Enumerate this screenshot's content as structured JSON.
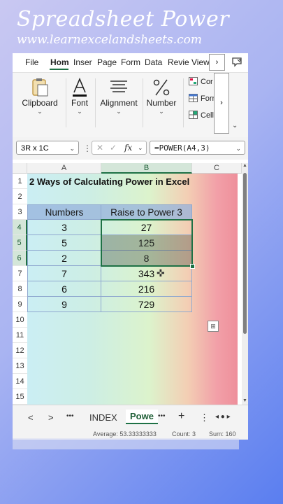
{
  "brand": {
    "title": "Spreadsheet Power",
    "subtitle": "www.learnexcelandsheets.com"
  },
  "menu": {
    "tabs": [
      "File",
      "Hom",
      "Inser",
      "Page",
      "Form",
      "Data",
      "Revie",
      "View"
    ],
    "active_tab": "Hom",
    "more_label": "›"
  },
  "ribbon": {
    "groups": [
      {
        "label": "Clipboard",
        "icon": "clipboard-icon"
      },
      {
        "label": "Font",
        "icon": "font-color-icon"
      },
      {
        "label": "Alignment",
        "icon": "align-icon"
      },
      {
        "label": "Number",
        "icon": "percent-icon"
      }
    ],
    "side_items": [
      "Cor",
      "Forr",
      "Cell"
    ],
    "more_label": "›",
    "collapse_label": "⌄"
  },
  "formula_bar": {
    "name_box": "3R x 1C",
    "formula": "=POWER(A4,3)"
  },
  "sheet": {
    "columns": [
      "A",
      "B",
      "C"
    ],
    "rows": [
      "1",
      "2",
      "3",
      "4",
      "5",
      "6",
      "7",
      "8",
      "9",
      "10",
      "11",
      "12",
      "13",
      "14",
      "15"
    ],
    "title": "2 Ways of Calculating Power in Excel",
    "headers": [
      "Numbers",
      "Raise to Power 3"
    ],
    "data": [
      [
        "3",
        "27"
      ],
      [
        "5",
        "125"
      ],
      [
        "2",
        "8"
      ],
      [
        "7",
        "343"
      ],
      [
        "6",
        "216"
      ],
      [
        "9",
        "729"
      ]
    ]
  },
  "sheet_tabs": {
    "nav_prev": "<",
    "nav_next": ">",
    "more": "•••",
    "tabs": [
      "INDEX",
      "Powe"
    ],
    "active": "Powe",
    "add": "+",
    "menu": "⋮"
  },
  "status": {
    "average": "Average: 53.33333333",
    "count": "Count: 3",
    "sum": "Sum: 160"
  },
  "colors": {
    "accent": "#1e7145",
    "header_fill": "#96b2dc"
  }
}
